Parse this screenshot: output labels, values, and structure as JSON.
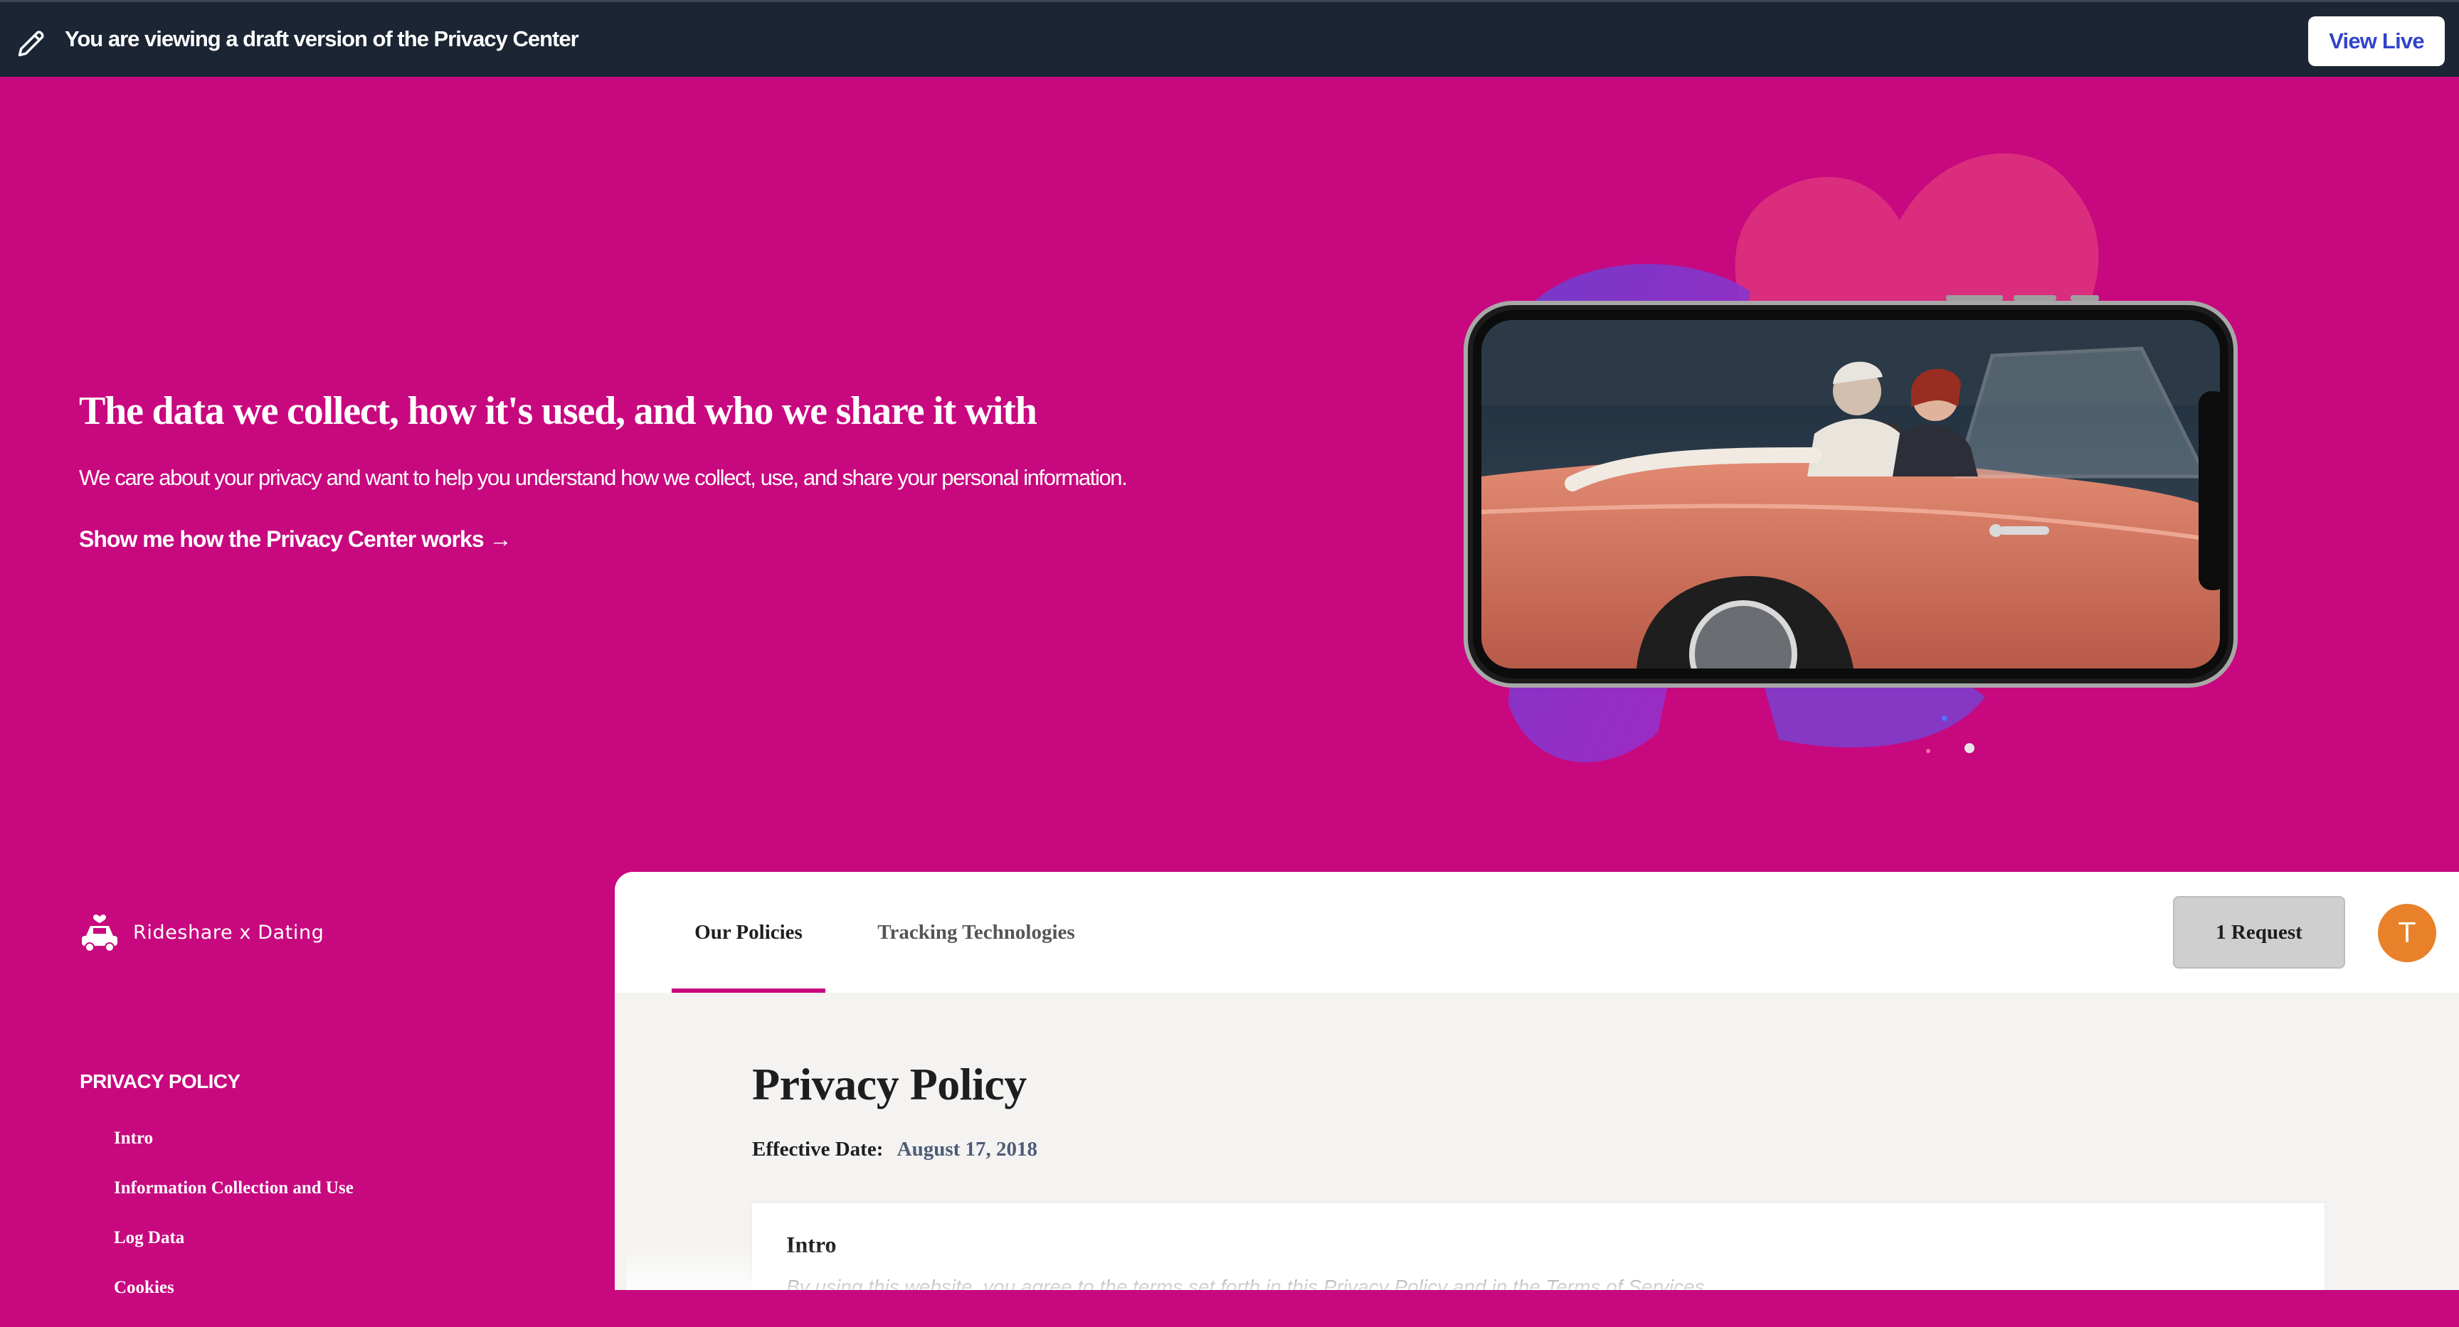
{
  "banner": {
    "icon": "pencil-icon",
    "text": "You are viewing a draft version of the Privacy Center",
    "view_live_label": "View Live"
  },
  "hero": {
    "title": "The data we collect, how it's used, and who we share it with",
    "description": "We care about your privacy and want to help you understand how we collect, use, and share your personal information.",
    "link_label": "Show me how the Privacy Center works →",
    "illustration": "phone-with-convertible-car-image"
  },
  "brand": {
    "logo": "car-logo-icon",
    "name": "Rideshare x Dating"
  },
  "sidebar": {
    "heading": "PRIVACY POLICY",
    "items": [
      {
        "label": "Intro"
      },
      {
        "label": "Information Collection and Use"
      },
      {
        "label": "Log Data"
      },
      {
        "label": "Cookies"
      }
    ]
  },
  "tabs": [
    {
      "label": "Our Policies",
      "active": true
    },
    {
      "label": "Tracking Technologies",
      "active": false
    }
  ],
  "header": {
    "request_label": "1 Request",
    "avatar_initial": "T"
  },
  "policy": {
    "title": "Privacy Policy",
    "effective_label": "Effective Date:",
    "effective_date": "August 17, 2018",
    "section_title": "Intro",
    "section_body": "By using this website, you agree to the terms set forth in this Privacy Policy and in the Terms of Services."
  },
  "colors": {
    "brand_pink": "#c8087f",
    "banner_dark": "#1b2533",
    "view_live_text": "#3143c9",
    "avatar_orange": "#e8812a"
  }
}
